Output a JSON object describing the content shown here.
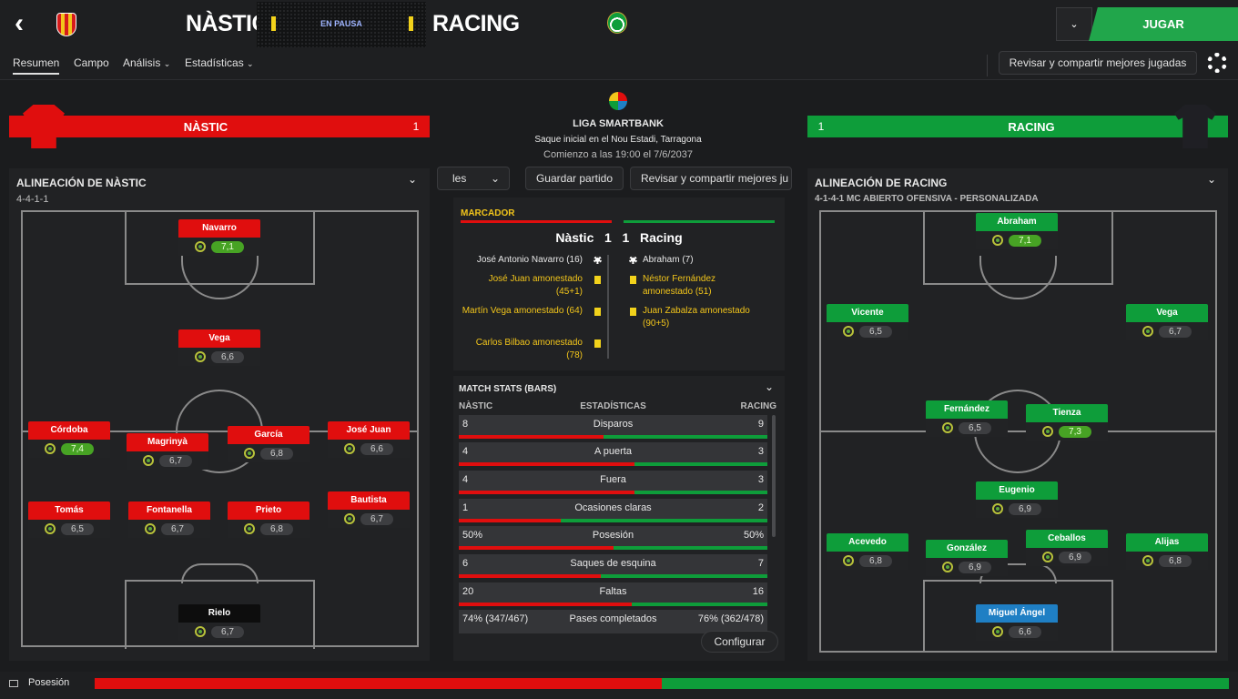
{
  "header": {
    "home_team": "NÀSTIC",
    "away_team": "RACING",
    "status": "EN PAUSA",
    "play_button": "JUGAR"
  },
  "nav": {
    "tabs": [
      "Resumen",
      "Campo",
      "Análisis",
      "Estadísticas"
    ],
    "share_button": "Revisar y compartir mejores jugadas"
  },
  "match": {
    "competition": "LIGA SMARTBANK",
    "kickoff": "Saque inicial en el Nou Estadi, Tarragona",
    "start": "Comienzo a las 19:00 el 7/6/2037",
    "btn_partial": "les",
    "save_button": "Guardar partido",
    "share_button2": "Revisar y compartir mejores ju"
  },
  "home": {
    "banner": "NÀSTIC",
    "score": "1",
    "lineup_title": "ALINEACIÓN DE NÀSTIC",
    "formation": "4-4-1-1",
    "players": [
      {
        "name": "Navarro",
        "rating": "7,1",
        "hi": true
      },
      {
        "name": "Vega",
        "rating": "6,6",
        "hi": false
      },
      {
        "name": "Córdoba",
        "rating": "7,4",
        "hi": true
      },
      {
        "name": "Magrinyà",
        "rating": "6,7",
        "hi": false
      },
      {
        "name": "García",
        "rating": "6,8",
        "hi": false
      },
      {
        "name": "José Juan",
        "rating": "6,6",
        "hi": false
      },
      {
        "name": "Tomás",
        "rating": "6,5",
        "hi": false
      },
      {
        "name": "Fontanella",
        "rating": "6,7",
        "hi": false
      },
      {
        "name": "Prieto",
        "rating": "6,8",
        "hi": false
      },
      {
        "name": "Bautista",
        "rating": "6,7",
        "hi": false
      },
      {
        "name": "Rielo",
        "rating": "6,7",
        "hi": false
      }
    ]
  },
  "away": {
    "banner": "RACING",
    "score": "1",
    "lineup_title": "ALINEACIÓN DE RACING",
    "formation": "4-1-4-1 MC ABIERTO OFENSIVA - PERSONALIZADA",
    "players": [
      {
        "name": "Abraham",
        "rating": "7,1",
        "hi": true
      },
      {
        "name": "Vicente",
        "rating": "6,5",
        "hi": false
      },
      {
        "name": "Vega",
        "rating": "6,7",
        "hi": false
      },
      {
        "name": "Fernández",
        "rating": "6,5",
        "hi": false
      },
      {
        "name": "Tienza",
        "rating": "7,3",
        "hi": true
      },
      {
        "name": "Eugenio",
        "rating": "6,9",
        "hi": false
      },
      {
        "name": "Acevedo",
        "rating": "6,8",
        "hi": false
      },
      {
        "name": "González",
        "rating": "6,9",
        "hi": false
      },
      {
        "name": "Ceballos",
        "rating": "6,9",
        "hi": false
      },
      {
        "name": "Alijas",
        "rating": "6,8",
        "hi": false
      },
      {
        "name": "Miguel Ángel",
        "rating": "6,6",
        "hi": false
      }
    ]
  },
  "scoreboard": {
    "title": "MARCADOR",
    "home": "Nàstic",
    "home_score": "1",
    "away_score": "1",
    "away": "Racing",
    "home_events": [
      {
        "text": "José Antonio Navarro (16)",
        "type": "goal"
      },
      {
        "text": "José Juan amonestado (45+1)",
        "type": "yellow"
      },
      {
        "text": "Martín Vega amonestado (64)",
        "type": "yellow"
      },
      {
        "text": "Carlos Bilbao amonestado (78)",
        "type": "yellow"
      }
    ],
    "away_events": [
      {
        "text": "Abraham (7)",
        "type": "goal"
      },
      {
        "text": "Néstor Fernández amonestado (51)",
        "type": "yellow"
      },
      {
        "text": "Juan Zabalza amonestado (90+5)",
        "type": "yellow"
      }
    ]
  },
  "stats": {
    "title": "MATCH STATS (BARS)",
    "home_label": "NÀSTIC",
    "mid_label": "ESTADÍSTICAS",
    "away_label": "RACING",
    "rows": [
      {
        "name": "Disparos",
        "home": "8",
        "away": "9",
        "home_share": 0.47
      },
      {
        "name": "A puerta",
        "home": "4",
        "away": "3",
        "home_share": 0.57
      },
      {
        "name": "Fuera",
        "home": "4",
        "away": "3",
        "home_share": 0.57
      },
      {
        "name": "Ocasiones claras",
        "home": "1",
        "away": "2",
        "home_share": 0.33
      },
      {
        "name": "Posesión",
        "home": "50%",
        "away": "50%",
        "home_share": 0.5
      },
      {
        "name": "Saques de esquina",
        "home": "6",
        "away": "7",
        "home_share": 0.46
      },
      {
        "name": "Faltas",
        "home": "20",
        "away": "16",
        "home_share": 0.56
      }
    ],
    "passes": {
      "name": "Pases completados",
      "home": "74% (347/467)",
      "away": "76% (362/478)"
    },
    "configure_button": "Configurar"
  },
  "footer": {
    "label": "Posesión",
    "home_share": 0.5
  },
  "colors": {
    "home": "#e00e0e",
    "away": "#0e9d3a",
    "accent": "#21a64b",
    "yellow": "#f2c51b"
  }
}
